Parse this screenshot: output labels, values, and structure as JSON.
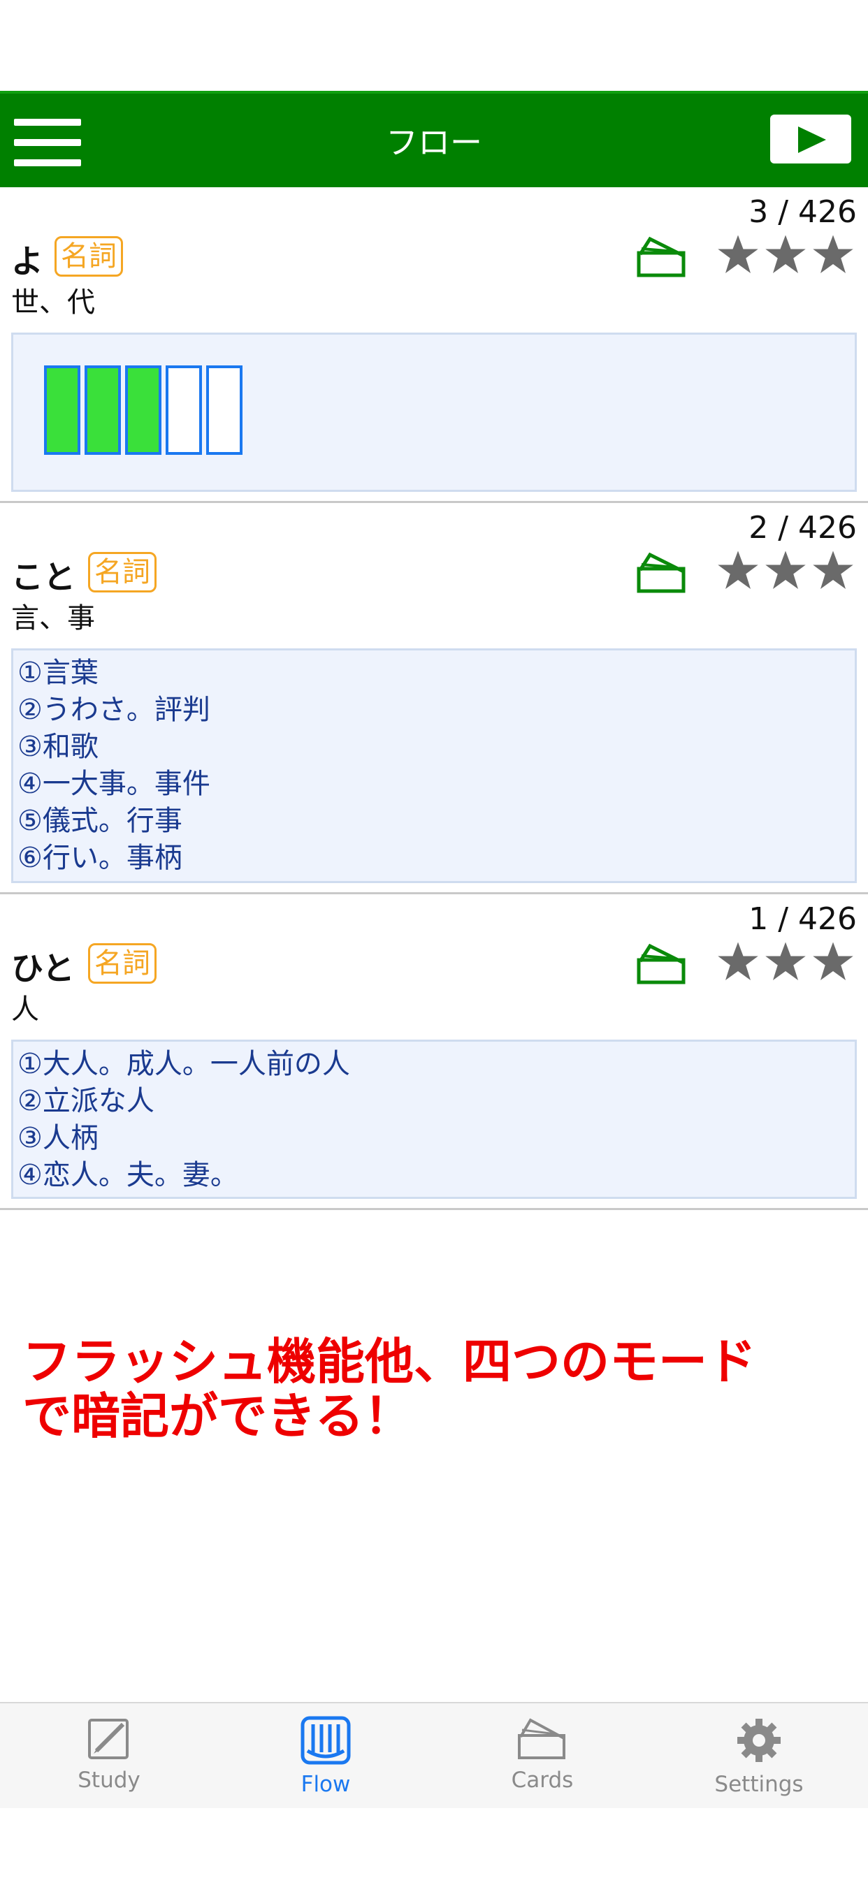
{
  "header": {
    "title": "フロー",
    "menu_icon": "hamburger-menu-icon",
    "play_icon": "play-icon",
    "accent_color": "#008000"
  },
  "cards": [
    {
      "counter": "3 / 426",
      "word": "よ",
      "pos": "名詞",
      "kanji": "世、代",
      "progress_filled": 3,
      "progress_total": 5,
      "definitions": []
    },
    {
      "counter": "2 / 426",
      "word": "こと",
      "pos": "名詞",
      "kanji": "言、事",
      "definitions": [
        "①言葉",
        "②うわさ。評判",
        "③和歌",
        "④一大事。事件",
        "⑤儀式。行事",
        "⑥行い。事柄"
      ]
    },
    {
      "counter": "1 / 426",
      "word": "ひと",
      "pos": "名詞",
      "kanji": "人",
      "definitions": [
        "①大人。成人。一人前の人",
        "②立派な人",
        "③人柄",
        "④恋人。夫。妻。"
      ]
    }
  ],
  "promo": {
    "line1": "フラッシュ機能他、四つのモード",
    "line2": "で暗記ができる！",
    "color": "#ee0000"
  },
  "tabbar": {
    "items": [
      {
        "label": "Study",
        "icon": "pencil-icon"
      },
      {
        "label": "Flow",
        "icon": "flow-icon",
        "active": true
      },
      {
        "label": "Cards",
        "icon": "cards-icon"
      },
      {
        "label": "Settings",
        "icon": "gear-icon"
      }
    ],
    "active_color": "#1a78f0"
  }
}
